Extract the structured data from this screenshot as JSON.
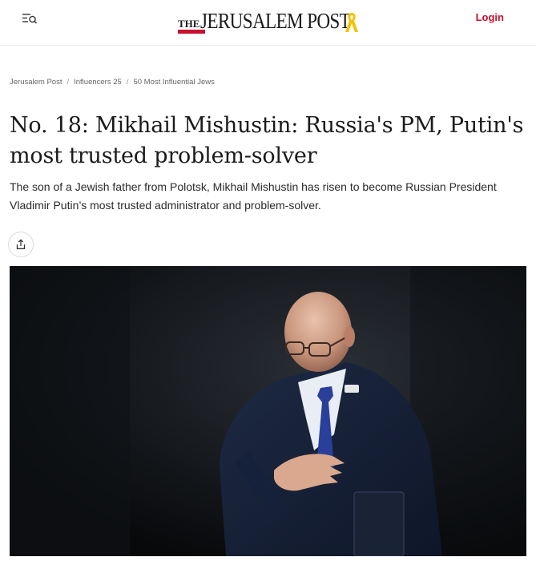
{
  "header": {
    "menu_icon": "menu-search-icon",
    "logo_the": "THE",
    "logo_text": "JERUSALEM POST",
    "logo_ribbon_color": "#f2c200",
    "login_label": "Login",
    "accent_color": "#c8102e"
  },
  "breadcrumb": {
    "items": [
      {
        "label": "Jerusalem Post"
      },
      {
        "label": "Influencers 25"
      },
      {
        "label": "50 Most Influential Jews"
      }
    ],
    "separator": "/"
  },
  "article": {
    "title": "No. 18: Mikhail Mishustin: Russia's PM, Putin's most trusted problem-solver",
    "subtitle": "The son of a Jewish father from Polotsk, Mikhail Mishustin has risen to become Russian President Vladimir Putin’s most trusted administrator and problem-solver.",
    "share_icon": "share-icon"
  },
  "hero_image": {
    "description_icon": "photo"
  }
}
